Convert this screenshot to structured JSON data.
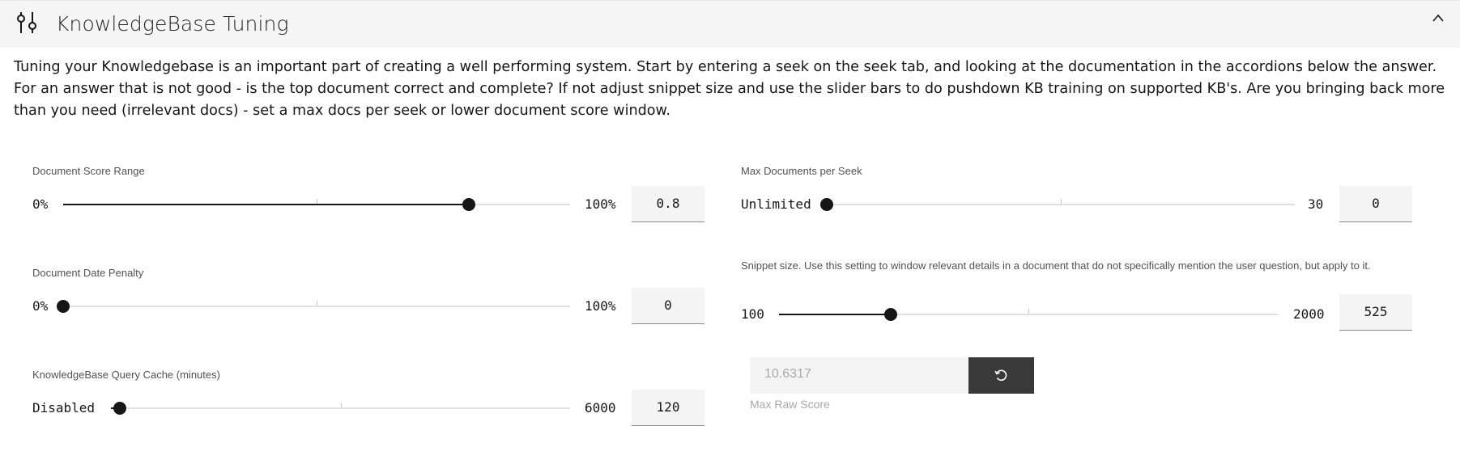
{
  "accordion": {
    "title": "KnowledgeBase Tuning",
    "icon": "sliders-icon",
    "toggle_icon": "chevron-up-icon",
    "description": "Tuning your Knowledgebase is an important part of creating a well performing system. Start by entering a seek on the seek tab, and looking at the documentation in the accordions below the answer. For an answer that is not good - is the top document correct and complete? If not adjust snippet size and use the slider bars to do pushdown KB training on supported KB's. Are you bringing back more than you need (irrelevant docs) - set a max docs per seek or lower document score window."
  },
  "sliders": {
    "score_range": {
      "label": "Document Score Range",
      "min_label": "0%",
      "max_label": "100%",
      "value": "0.8",
      "fraction": 0.8
    },
    "date_penalty": {
      "label": "Document Date Penalty",
      "min_label": "0%",
      "max_label": "100%",
      "value": "0",
      "fraction": 0
    },
    "query_cache": {
      "label": "KnowledgeBase Query Cache (minutes)",
      "min_label": "Disabled",
      "max_label": "6000",
      "value": "120",
      "fraction": 0.02
    },
    "max_docs": {
      "label": "Max Documents per Seek",
      "min_label": "Unlimited",
      "max_label": "30",
      "value": "0",
      "fraction": 0
    },
    "snippet_size": {
      "label": "Snippet size. Use this setting to window relevant details in a document that do not specifically mention the user question, but apply to it.",
      "min_label": "100",
      "max_label": "2000",
      "value": "525",
      "fraction": 0.2237
    }
  },
  "max_raw_score": {
    "value": "10.6317",
    "label": "Max Raw Score",
    "button_icon": "reset-icon"
  },
  "colors": {
    "header_bg": "#f5f5f5",
    "slider_active": "#161616",
    "slider_track": "#e0e0e0",
    "input_bg": "#f4f4f4",
    "button_bg": "#393939"
  }
}
